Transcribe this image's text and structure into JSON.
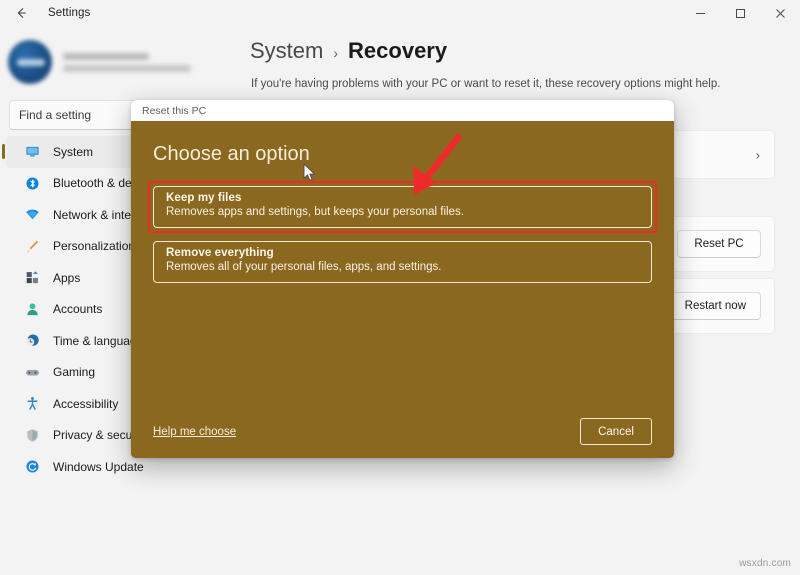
{
  "window": {
    "app_title": "Settings",
    "back_icon": "back-arrow-icon",
    "controls": {
      "minimize_label": "Minimize",
      "maximize_label": "Maximize",
      "close_label": "Close"
    }
  },
  "sidebar": {
    "profile": {
      "name": "",
      "email": ""
    },
    "search": {
      "placeholder": "Find a setting",
      "value": ""
    },
    "items": [
      {
        "label": "System",
        "icon": "monitor-icon",
        "selected": true
      },
      {
        "label": "Bluetooth & devices",
        "icon": "bluetooth-icon",
        "selected": false
      },
      {
        "label": "Network & internet",
        "icon": "wifi-icon",
        "selected": false
      },
      {
        "label": "Personalization",
        "icon": "paintbrush-icon",
        "selected": false
      },
      {
        "label": "Apps",
        "icon": "apps-grid-icon",
        "selected": false
      },
      {
        "label": "Accounts",
        "icon": "person-icon",
        "selected": false
      },
      {
        "label": "Time & language",
        "icon": "clock-globe-icon",
        "selected": false
      },
      {
        "label": "Gaming",
        "icon": "gamepad-icon",
        "selected": false
      },
      {
        "label": "Accessibility",
        "icon": "accessibility-icon",
        "selected": false
      },
      {
        "label": "Privacy & security",
        "icon": "shield-icon",
        "selected": false
      },
      {
        "label": "Windows Update",
        "icon": "update-sync-icon",
        "selected": false
      }
    ]
  },
  "content": {
    "breadcrumb": {
      "root": "System",
      "separator": "›",
      "leaf": "Recovery"
    },
    "description": "If you're having problems with your PC or want to reset it, these recovery options might help.",
    "cards": [
      {
        "action_label": "",
        "chevron": "›"
      },
      {
        "action_label": "Reset PC",
        "chevron": ""
      },
      {
        "action_label": "Restart now",
        "chevron": ""
      }
    ]
  },
  "dialog": {
    "title": "Reset this PC",
    "heading": "Choose an option",
    "options": [
      {
        "title": "Keep my files",
        "subtitle": "Removes apps and settings, but keeps your personal files.",
        "highlighted": true
      },
      {
        "title": "Remove everything",
        "subtitle": "Removes all of your personal files, apps, and settings.",
        "highlighted": false
      }
    ],
    "help_link": "Help me choose",
    "cancel_label": "Cancel",
    "background_color": "#8b6820",
    "text_color": "#f6edd9"
  },
  "annotations": {
    "arrow_color": "#ef2a2a",
    "highlight_color": "#ef2a2a",
    "cursor_icon": "mouse-pointer-icon"
  },
  "watermark": "wsxdn.com"
}
